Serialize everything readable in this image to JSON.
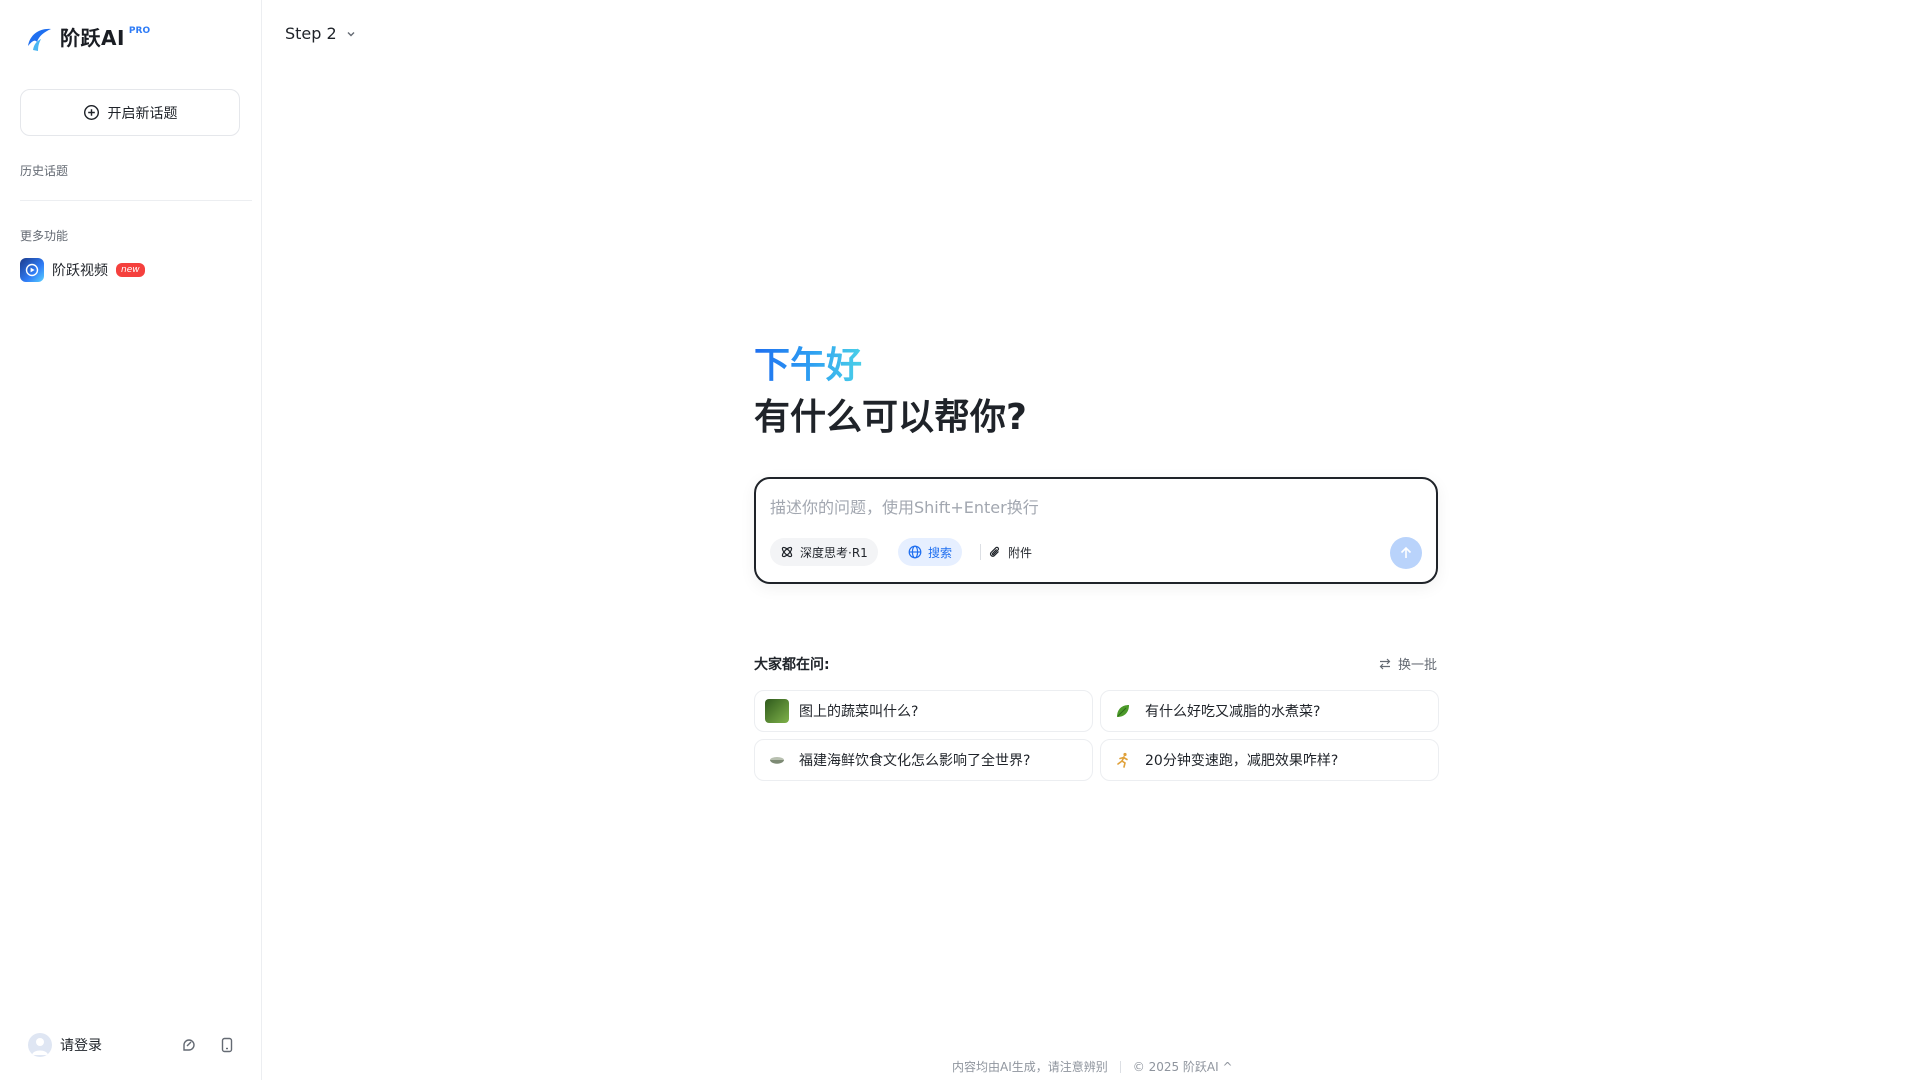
{
  "brand": {
    "name": "阶跃AI",
    "tag": "PRO"
  },
  "sidebar": {
    "new_topic_label": "开启新话题",
    "history_label": "历史话题",
    "more_label": "更多功能",
    "features": [
      {
        "label": "阶跃视频",
        "badge": "new"
      }
    ],
    "login_label": "请登录"
  },
  "topbar": {
    "model_select": "Step 2"
  },
  "main": {
    "greeting": "下午好",
    "headline": "有什么可以帮你?",
    "input": {
      "placeholder": "描述你的问题，使用Shift+Enter换行",
      "value": "",
      "chips": {
        "deep_think": "深度思考·R1",
        "search": "搜索",
        "attach": "附件"
      }
    },
    "suggest": {
      "label": "大家都在问:",
      "refresh": "换一批",
      "items": [
        {
          "icon": "vegetable-photo-icon",
          "text": "图上的蔬菜叫什么?"
        },
        {
          "icon": "leaf-icon",
          "text": "有什么好吃又减脂的水煮菜?"
        },
        {
          "icon": "seafood-bowl-icon",
          "text": "福建海鲜饮食文化怎么影响了全世界?"
        },
        {
          "icon": "runner-icon",
          "text": "20分钟变速跑，减肥效果咋样?"
        }
      ]
    }
  },
  "footer": {
    "disclaimer": "内容均由AI生成，请注意辨别",
    "copyright": "© 2025 阶跃AI ^"
  },
  "colors": {
    "accent": "#1f6ff0",
    "badge": "#f5403d",
    "send_disabled": "#b9d3fb"
  }
}
